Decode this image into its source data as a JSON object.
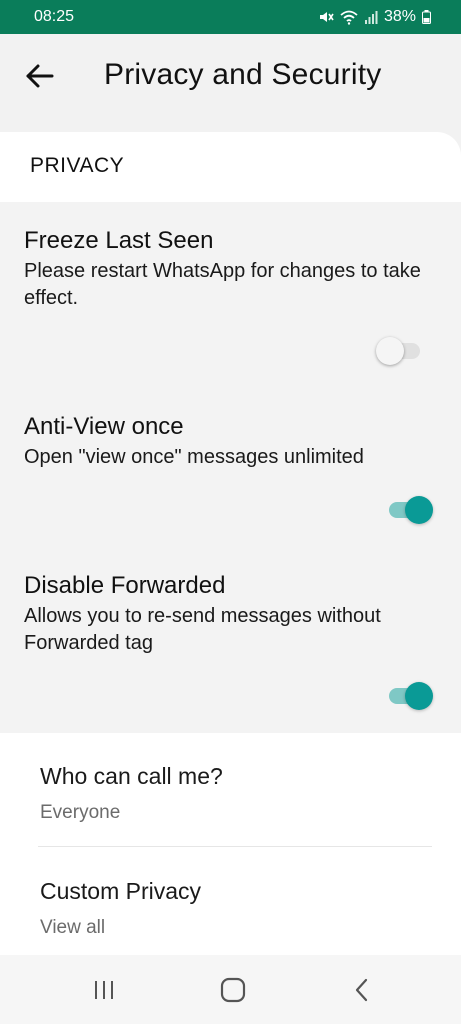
{
  "status_bar": {
    "time": "08:25",
    "battery": "38%",
    "icons": [
      "mute-icon",
      "wifi-icon",
      "signal-icon",
      "battery-icon"
    ]
  },
  "header": {
    "title": "Privacy and Security",
    "back_icon": "back-arrow-icon"
  },
  "privacy_section": {
    "header": "PRIVACY",
    "toggles": [
      {
        "title": "Freeze Last Seen",
        "description": "Please restart WhatsApp for changes to take effect.",
        "enabled": false
      },
      {
        "title": "Anti-View once",
        "description": "Open \"view once\" messages unlimited",
        "enabled": true
      },
      {
        "title": "Disable Forwarded",
        "description": "Allows you to re-send messages without Forwarded tag",
        "enabled": true
      }
    ],
    "preferences": [
      {
        "title": "Who can call me?",
        "value": "Everyone"
      },
      {
        "title": "Custom Privacy",
        "value": "View all"
      }
    ]
  },
  "nav_bar": {
    "buttons": [
      "recent-apps-icon",
      "home-icon",
      "back-icon"
    ]
  },
  "colors": {
    "status_bar": "#0a7d5a",
    "toggle_on": "#0a9a96",
    "toggle_track_on": "#7fc8c5"
  }
}
